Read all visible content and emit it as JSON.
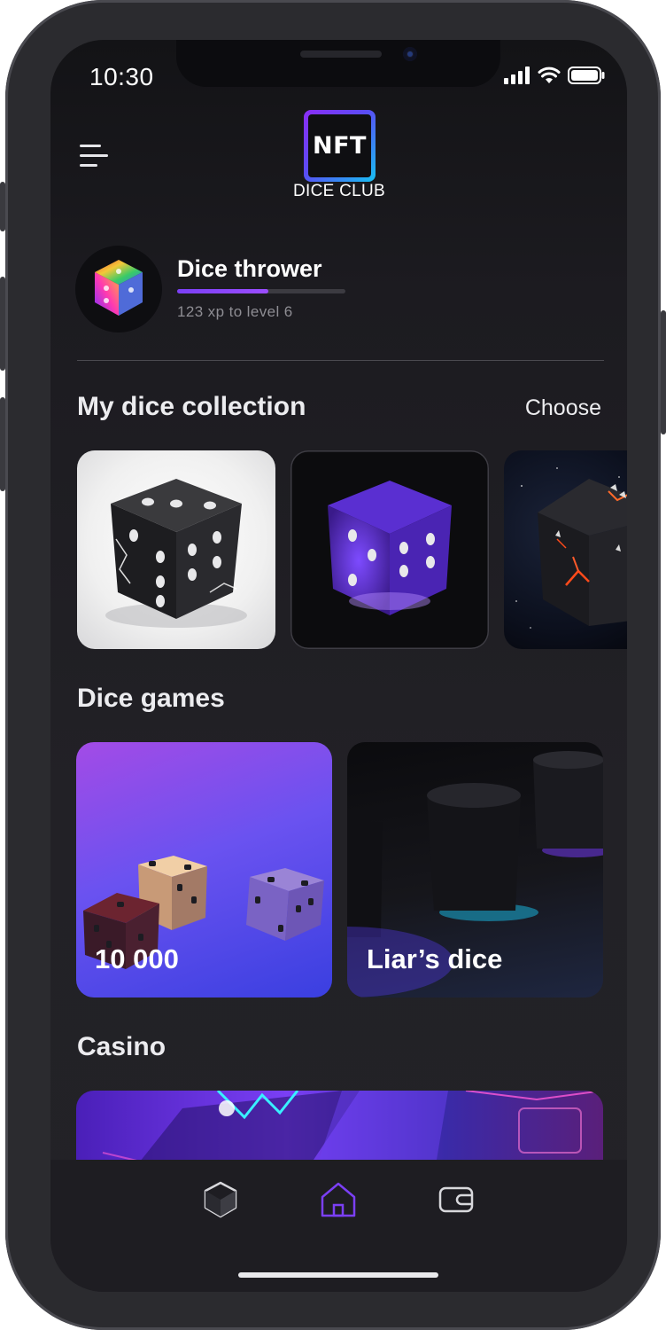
{
  "status_bar": {
    "time": "10:30"
  },
  "header": {
    "logo_text": "NFT",
    "logo_subtitle": "DICE CLUB"
  },
  "profile": {
    "name": "Dice thrower",
    "xp_text": "123 xp to level 6",
    "xp_progress": 0.54
  },
  "collection": {
    "title": "My dice collection",
    "action_label": "Choose",
    "items": [
      {
        "name": "black-marble-dice"
      },
      {
        "name": "purple-glow-dice"
      },
      {
        "name": "lava-crack-dice"
      }
    ]
  },
  "games": {
    "title": "Dice games",
    "items": [
      {
        "label": "10 000"
      },
      {
        "label": "Liar’s dice"
      }
    ]
  },
  "casino": {
    "title": "Casino"
  },
  "bottom_nav": {
    "items": [
      {
        "icon": "cube-icon",
        "active": false
      },
      {
        "icon": "home-icon",
        "active": true
      },
      {
        "icon": "wallet-icon",
        "active": false
      }
    ]
  },
  "colors": {
    "accent": "#7b3ff5",
    "background": "#1c1b20",
    "text": "#ececef"
  }
}
